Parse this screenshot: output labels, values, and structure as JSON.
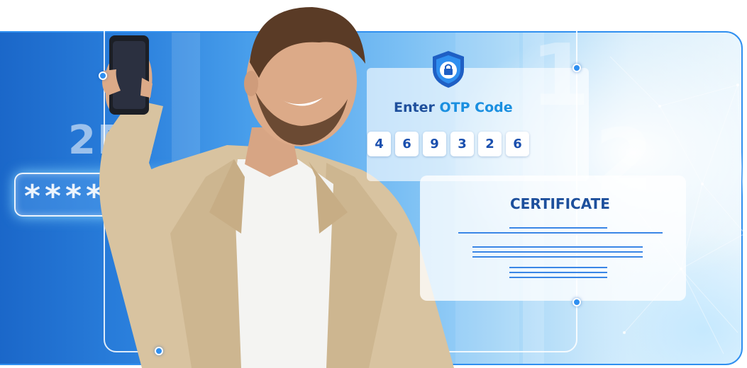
{
  "badge_text": "2FA",
  "password_mask": "******",
  "otp": {
    "title_prefix": "Enter ",
    "title_accent": "OTP Code",
    "digits": [
      "4",
      "6",
      "9",
      "3",
      "2",
      "6"
    ],
    "icon": "shield-lock-icon"
  },
  "certificate": {
    "title": "CERTIFICATE"
  },
  "step_numbers": [
    "1",
    "2"
  ],
  "colors": {
    "brand_blue": "#2f8ff0",
    "dark_text": "#1d4f9c",
    "accent_text": "#1a8fe0"
  }
}
